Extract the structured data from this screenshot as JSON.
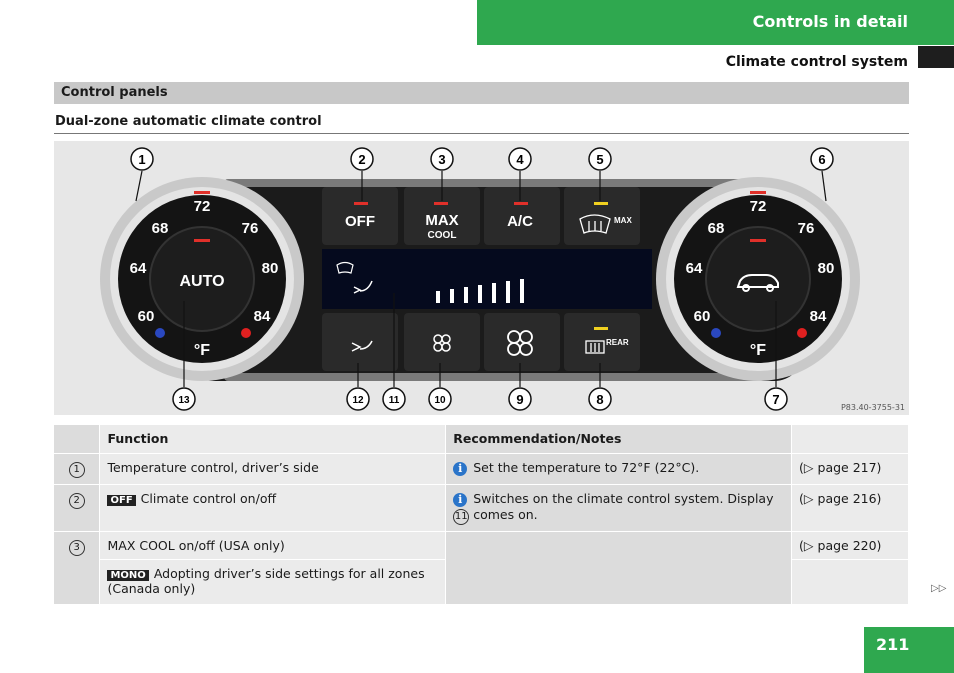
{
  "header": {
    "title": "Controls in detail",
    "subtitle": "Climate control system"
  },
  "section": {
    "title": "Control panels",
    "subsection": "Dual-zone automatic climate control"
  },
  "figure": {
    "code": "P83.40-3755-31",
    "callouts": [
      "1",
      "2",
      "3",
      "4",
      "5",
      "6",
      "7",
      "8",
      "9",
      "10",
      "11",
      "12",
      "13"
    ],
    "left_dial": {
      "temps": [
        "72",
        "76",
        "80",
        "84",
        "60",
        "64",
        "68"
      ],
      "center": "AUTO",
      "unit": "°F"
    },
    "right_dial": {
      "temps": [
        "72",
        "76",
        "80",
        "84",
        "60",
        "64",
        "68"
      ],
      "unit": "°F"
    },
    "buttons": {
      "off": "OFF",
      "max": "MAX",
      "cool": "COOL",
      "ac": "A/C",
      "defrost_max": "MAX",
      "rear": "REAR"
    }
  },
  "table": {
    "headers": {
      "function": "Function",
      "notes": "Recommendation/Notes"
    },
    "rows": [
      {
        "num": "1",
        "function": "Temperature control, driver’s side",
        "note": "Set the temperature to 72°F (22°C).",
        "ref": "(▷ page 217)"
      },
      {
        "num": "2",
        "badge": "OFF",
        "function": "Climate control on/off",
        "note": "Switches on the climate control system. Display",
        "note_ref": "11",
        "note_end": "comes on.",
        "ref": "(▷ page 216)"
      },
      {
        "num": "3",
        "function": "MAX COOL on/off (USA only)",
        "ref": "(▷ page 220)"
      },
      {
        "badge": "MONO",
        "function": "Adopting driver’s side settings for all zones (Canada only)"
      }
    ]
  },
  "continue_marker": "▷▷",
  "page_number": "211"
}
